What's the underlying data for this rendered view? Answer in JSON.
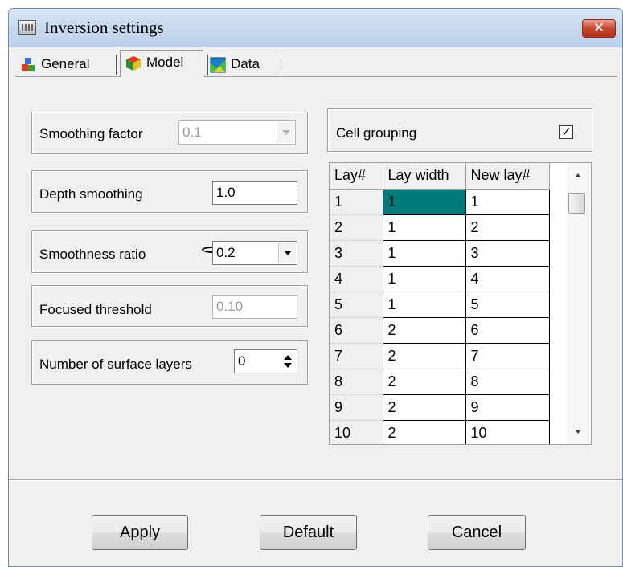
{
  "window": {
    "title": "Inversion settings",
    "close_glyph": "✕"
  },
  "tabs": [
    {
      "label": "General",
      "icon": "general-icon"
    },
    {
      "label": "Model",
      "icon": "model-icon",
      "active": true
    },
    {
      "label": "Data",
      "icon": "data-icon"
    }
  ],
  "model": {
    "smoothing_factor": {
      "label": "Smoothing factor",
      "value": "0.1",
      "enabled": false
    },
    "depth_smoothing": {
      "label": "Depth smoothing",
      "value": "1.0"
    },
    "smoothness_ratio": {
      "label": "Smoothness ratio",
      "value": "0.2",
      "icon": "ellipse-icon"
    },
    "focused_threshold": {
      "label": "Focused threshold",
      "value": "0.10",
      "enabled": false
    },
    "surface_layers": {
      "label": "Number of  surface layers",
      "value": "0"
    },
    "cell_grouping": {
      "label": "Cell grouping",
      "checked": true,
      "check_glyph": "✓"
    }
  },
  "grid": {
    "columns": [
      "Lay#",
      "Lay width",
      "New lay#"
    ],
    "rows": [
      [
        "1",
        "1",
        "1"
      ],
      [
        "2",
        "1",
        "2"
      ],
      [
        "3",
        "1",
        "3"
      ],
      [
        "4",
        "1",
        "4"
      ],
      [
        "5",
        "1",
        "5"
      ],
      [
        "6",
        "2",
        "6"
      ],
      [
        "7",
        "2",
        "7"
      ],
      [
        "8",
        "2",
        "8"
      ],
      [
        "9",
        "2",
        "9"
      ],
      [
        "10",
        "2",
        "10"
      ]
    ],
    "selected_cell": "row 1, Lay width"
  },
  "buttons": {
    "apply": "Apply",
    "default": "Default",
    "cancel": "Cancel"
  },
  "colors": {
    "selection": "#007a7a",
    "close_button": "#c7452e",
    "title_bar": "#c6d8ee"
  }
}
